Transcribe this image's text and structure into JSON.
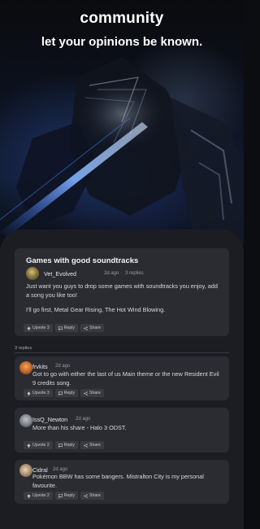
{
  "header": {
    "title": "community",
    "subtitle": "let your opinions be known."
  },
  "post": {
    "title": "Games with good soundtracks",
    "author": "Vet_Evolved",
    "time": "2d ago",
    "reply_count": "3 replies",
    "body_1": "Just want you guys to drop some games with soundtracks you enjoy, add a song you like too!",
    "body_2": "I'll go first, Metal Gear Rising, The Hot Wind Blowing.",
    "upvote": "Upvote 3",
    "reply": "Reply",
    "share": "Share"
  },
  "replies_label": "3 replies",
  "comments": [
    {
      "author": "frvkits",
      "time": "2d ago",
      "text": "Got to go with either the last of us Main theme or the new Resident Evil 9 credits song.",
      "upvote": "Upvote 3",
      "reply": "Reply",
      "share": "Share"
    },
    {
      "author": "IssQ_Newton",
      "time": "2d ago",
      "text": "More than his share - Halo 3 ODST.",
      "upvote": "Upvote 2",
      "reply": "Reply",
      "share": "Share"
    },
    {
      "author": "Cidral",
      "time": "2d ago",
      "text": "Pokémon BBW has some bangers. Mistralton City is my personal favourite.",
      "upvote": "Upvote 2",
      "reply": "Reply",
      "share": "Share"
    }
  ],
  "colors": {
    "background": "#1c1d22",
    "card": "#2b2c31",
    "button": "#3a3b41"
  },
  "icons": [
    "upvote-icon",
    "reply-icon",
    "share-icon",
    "avatar"
  ]
}
